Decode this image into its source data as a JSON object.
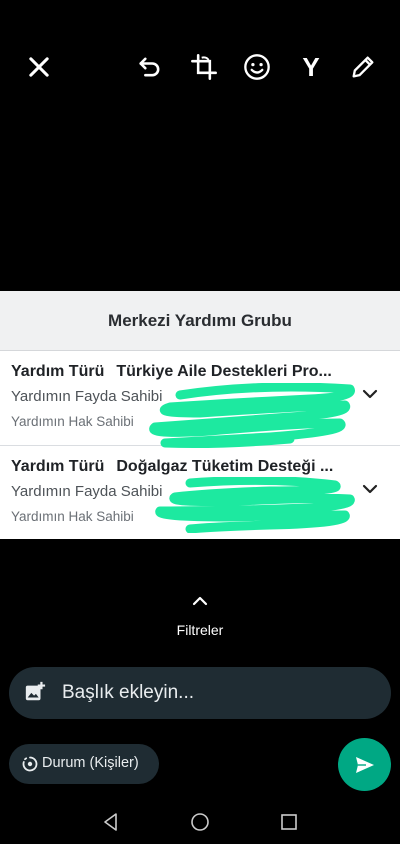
{
  "toolbar": {
    "close": "close-icon",
    "undo": "undo-icon",
    "crop": "crop-rotate-icon",
    "emoji": "emoji-icon",
    "text": "Y",
    "draw": "pencil-icon"
  },
  "card": {
    "title": "Merkezi Yardımı Grubu",
    "rows": [
      {
        "type_label": "Yardım Türü",
        "type_value": "Türkiye Aile Destekleri Pro...",
        "beneficiary_label": "Yardımın Fayda Sahibi",
        "holder_label": "Yardımın Hak Sahibi"
      },
      {
        "type_label": "Yardım Türü",
        "type_value": "Doğalgaz Tüketim Desteği ...",
        "beneficiary_label": "Yardımın Fayda Sahibi",
        "holder_label": "Yardımın Hak Sahibi"
      }
    ],
    "scribble_color": "#1de9a0"
  },
  "filters": {
    "label": "Filtreler"
  },
  "caption": {
    "placeholder": "Başlık ekleyin..."
  },
  "status": {
    "label": "Durum (Kişiler)"
  },
  "colors": {
    "accent": "#00a884",
    "pill": "#1f2c33"
  },
  "nav": [
    "back-icon",
    "home-icon",
    "recents-icon"
  ]
}
